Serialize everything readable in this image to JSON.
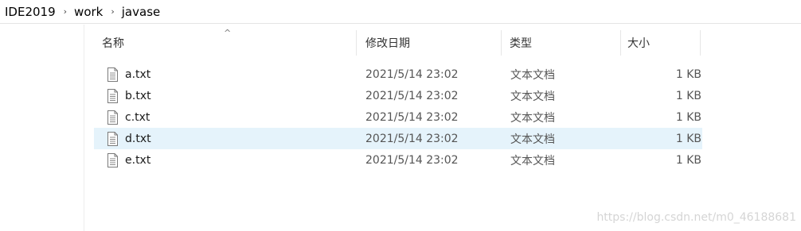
{
  "breadcrumb": [
    "IDE2019",
    "work",
    "javase"
  ],
  "breadcrumb_separator": "›",
  "columns": {
    "name": "名称",
    "date": "修改日期",
    "type": "类型",
    "size": "大小"
  },
  "sort_indicator": "^",
  "files": [
    {
      "name": "a.txt",
      "date": "2021/5/14 23:02",
      "type": "文本文档",
      "size": "1 KB",
      "selected": false
    },
    {
      "name": "b.txt",
      "date": "2021/5/14 23:02",
      "type": "文本文档",
      "size": "1 KB",
      "selected": false
    },
    {
      "name": "c.txt",
      "date": "2021/5/14 23:02",
      "type": "文本文档",
      "size": "1 KB",
      "selected": false
    },
    {
      "name": "d.txt",
      "date": "2021/5/14 23:02",
      "type": "文本文档",
      "size": "1 KB",
      "selected": true
    },
    {
      "name": "e.txt",
      "date": "2021/5/14 23:02",
      "type": "文本文档",
      "size": "1 KB",
      "selected": false
    }
  ],
  "file_icon": "text-document-icon",
  "watermark": "https://blog.csdn.net/m0_46188681",
  "colors": {
    "selection": "#e5f3fb"
  }
}
